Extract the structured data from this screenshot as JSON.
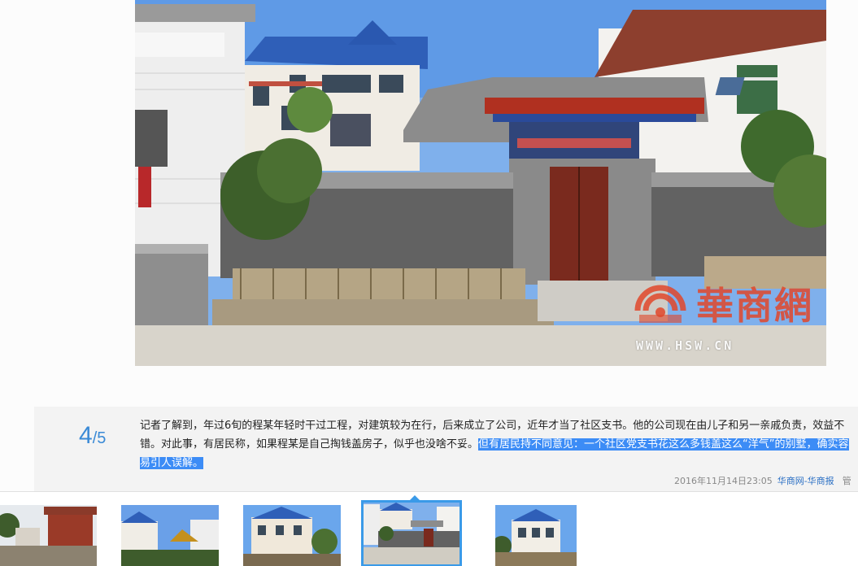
{
  "photo": {
    "watermark_brand": "華商網",
    "watermark_url": "WWW.HSW.CN"
  },
  "counter": {
    "current": "4",
    "separator": "/",
    "total": "5"
  },
  "caption": {
    "text_plain": "记者了解到，年过6旬的程某年轻时干过工程，对建筑较为在行，后来成立了公司，近年才当了社区支书。他的公司现在由儿子和另一亲戚负责，效益不错。对此事，有居民称，如果程某是自己掏钱盖房子，似乎也没啥不妥。",
    "text_selected": "但有居民持不同意见：一个社区党支书花这么多钱盖这么“洋气”的别墅，确实容易引人误解。"
  },
  "meta": {
    "timestamp": "2016年11月14日23:05",
    "source": "华商网-华商报",
    "overflow_text": "管"
  },
  "thumbnails": [
    {
      "label": "thumbnail 1",
      "active": false
    },
    {
      "label": "thumbnail 2",
      "active": false
    },
    {
      "label": "thumbnail 3",
      "active": false
    },
    {
      "label": "thumbnail 4",
      "active": true
    },
    {
      "label": "thumbnail 5",
      "active": false
    }
  ],
  "colors": {
    "accent": "#3a8ad6",
    "selection": "#3c8cf6",
    "source_link": "#2a6fc4",
    "watermark": "#e0462a"
  }
}
